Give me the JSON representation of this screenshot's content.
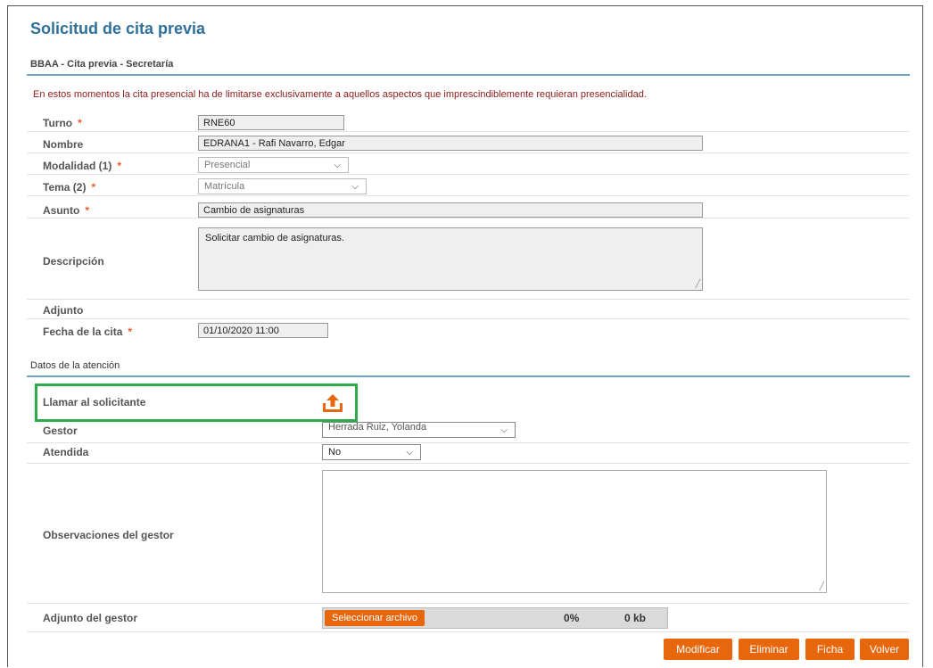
{
  "page_title": "Solicitud de cita previa",
  "breadcrumb": "BBAA - Cita previa - Secretaría",
  "notice": "En estos momentos la cita presencial ha de limitarse exclusivamente a aquellos aspectos que imprescindiblemente requieran presencialidad.",
  "required_mark": "*",
  "form": {
    "turno": {
      "label": "Turno",
      "value": "RNE60"
    },
    "nombre": {
      "label": "Nombre",
      "value": "EDRANA1 - Rafi Navarro, Edgar"
    },
    "modalidad": {
      "label": "Modalidad (1)",
      "value": "Presencial"
    },
    "tema": {
      "label": "Tema (2)",
      "value": "Matrícula"
    },
    "asunto": {
      "label": "Asunto",
      "value": "Cambio de asignaturas"
    },
    "descripcion": {
      "label": "Descripción",
      "value": "Solicitar cambio de asignaturas."
    },
    "adjunto": {
      "label": "Adjunto"
    },
    "fecha": {
      "label": "Fecha de la cita",
      "value": "01/10/2020 11:00"
    }
  },
  "atencion": {
    "section_title": "Datos de la atención",
    "llamar": {
      "label": "Llamar al solicitante",
      "icon": "upload-icon"
    },
    "gestor": {
      "label": "Gestor",
      "value": "Herrada Ruiz, Yolanda"
    },
    "atendida": {
      "label": "Atendida",
      "value": "No"
    },
    "observaciones": {
      "label": "Observaciones del gestor",
      "value": ""
    },
    "adjunto_gestor": {
      "label": "Adjunto del gestor",
      "button": "Seleccionar archivo",
      "progress": "0%",
      "size": "0 kb"
    }
  },
  "buttons": {
    "modificar": "Modificar",
    "eliminar": "Eliminar",
    "ficha": "Ficha",
    "volver": "Volver"
  },
  "colors": {
    "accent": "#e8670c",
    "title": "#2f6f99",
    "highlight": "#2eaa4a",
    "notice": "#8b1a1a"
  }
}
